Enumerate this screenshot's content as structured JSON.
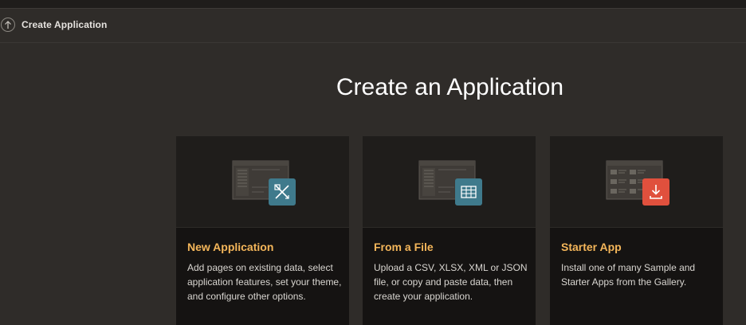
{
  "header": {
    "title": "Create Application",
    "back_icon": "arrow-up-icon"
  },
  "hero": {
    "title": "Create an Application"
  },
  "cards": [
    {
      "title": "New Application",
      "description": "Add pages on existing data, select application features, set your theme, and configure other options.",
      "icon": "pencil-ruler-icon",
      "accent": "#3f7a8c"
    },
    {
      "title": "From a File",
      "description": "Upload a CSV, XLSX, XML or JSON file, or copy and paste data, then create your application.",
      "icon": "table-grid-icon",
      "accent": "#3f7a8c"
    },
    {
      "title": "Starter App",
      "description": "Install one of many Sample and Starter Apps from the Gallery.",
      "icon": "download-icon",
      "accent": "#e0503d"
    }
  ],
  "colors": {
    "background": "#2f2c29",
    "card_background": "#151312",
    "card_title": "#f4b65a",
    "text": "#d9d6d1"
  }
}
